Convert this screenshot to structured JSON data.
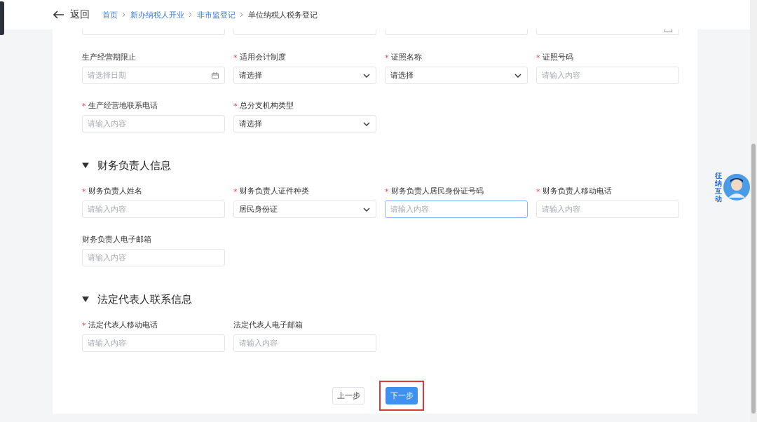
{
  "header": {
    "back_label": "返回",
    "breadcrumb": [
      {
        "label": "首页",
        "link": true
      },
      {
        "label": "新办纳税人开业",
        "link": true
      },
      {
        "label": "非市监登记",
        "link": true
      },
      {
        "label": "单位纳税人税务登记",
        "link": false
      }
    ]
  },
  "cut_row": [
    {
      "kind": "select"
    },
    {
      "kind": "input"
    },
    {
      "kind": "select"
    },
    {
      "kind": "date"
    }
  ],
  "sections": [
    {
      "fields": [
        {
          "label": "生产经营期限止",
          "kind": "date",
          "placeholder": "请选择日期",
          "focused": false
        },
        {
          "label": "适用会计制度",
          "required_mark": "*",
          "kind": "select",
          "value": "请选择",
          "focused": false
        },
        {
          "label": "证照名称",
          "required_mark": "*",
          "kind": "select",
          "value": "请选择",
          "focused": false
        },
        {
          "label": "证照号码",
          "required_mark": "*",
          "kind": "input",
          "placeholder": "请输入内容",
          "focused": false
        },
        {
          "label": "生产经营地联系电话",
          "required_mark": "*",
          "kind": "input",
          "placeholder": "请输入内容",
          "focused": false
        },
        {
          "label": "总分支机构类型",
          "required_mark": "*",
          "kind": "select",
          "value": "请选择",
          "focused": false
        }
      ]
    },
    {
      "title": "财务负责人信息",
      "expanded": true,
      "fields": [
        {
          "label": "财务负责人姓名",
          "required_mark": "*",
          "kind": "input",
          "placeholder": "请输入内容",
          "focused": false
        },
        {
          "label": "财务负责人证件种类",
          "required_mark": "*",
          "kind": "select",
          "value": "居民身份证",
          "focused": false
        },
        {
          "label": "财务负责人居民身份证号码",
          "required_mark": "*",
          "kind": "input",
          "placeholder": "请输入内容",
          "focused": true
        },
        {
          "label": "财务负责人移动电话",
          "required_mark": "*",
          "kind": "input",
          "placeholder": "请输入内容",
          "focused": false
        },
        {
          "label": "财务负责人电子邮箱",
          "kind": "input",
          "placeholder": "请输入内容",
          "focused": false
        }
      ]
    },
    {
      "title": "法定代表人联系信息",
      "expanded": true,
      "fields": [
        {
          "label": "法定代表人移动电话",
          "required_mark": "*",
          "kind": "input",
          "placeholder": "请输入内容",
          "focused": false
        },
        {
          "label": "法定代表人电子邮箱",
          "kind": "input",
          "placeholder": "请输入内容",
          "focused": false
        }
      ]
    }
  ],
  "buttons": [
    {
      "label": "上一步",
      "primary": false,
      "highlighted": false
    },
    {
      "label": "下一步",
      "primary": true,
      "highlighted": true
    }
  ],
  "assistant_badge": {
    "label": "征纳互动"
  }
}
